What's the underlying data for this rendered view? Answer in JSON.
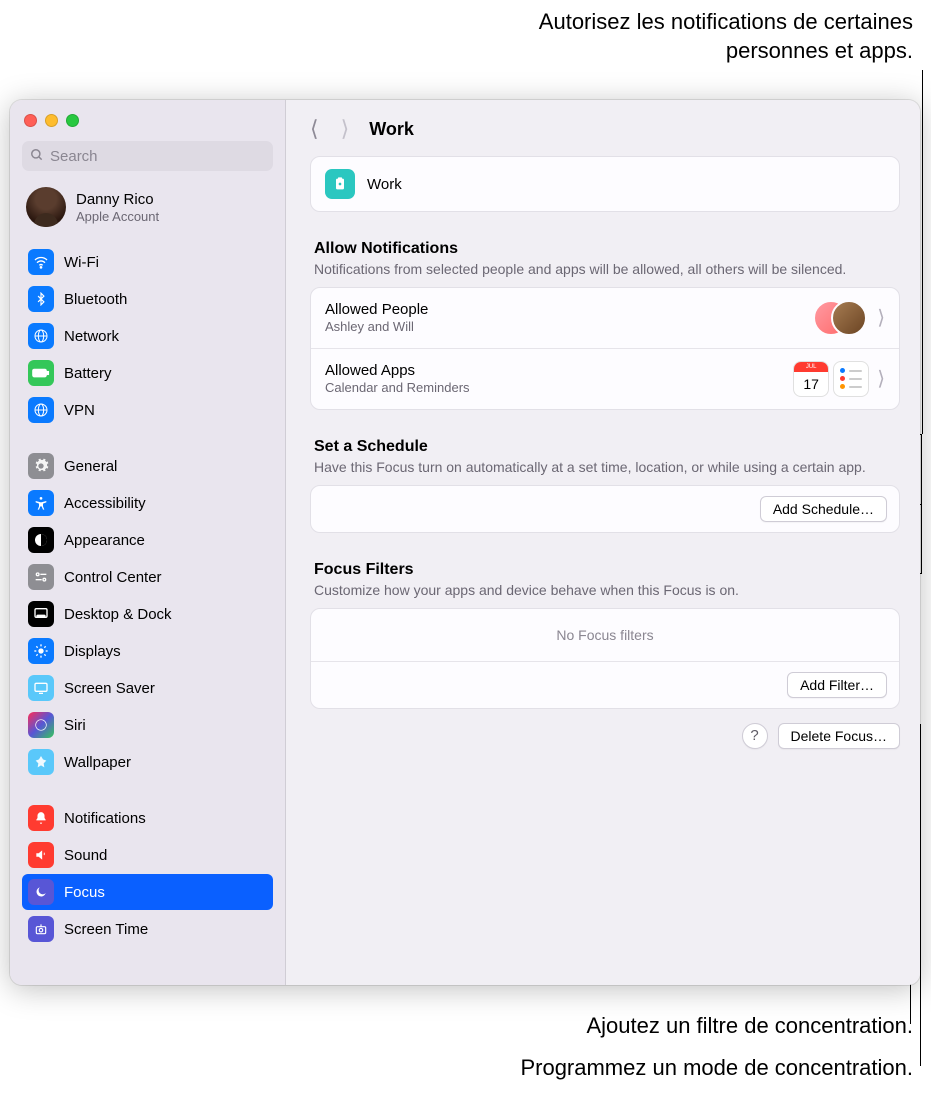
{
  "annotations": {
    "top": "Autorisez les notifications de certaines personnes et apps.",
    "filter": "Ajoutez un filtre de concentration.",
    "schedule": "Programmez un mode de concentration."
  },
  "search": {
    "placeholder": "Search"
  },
  "profile": {
    "name": "Danny Rico",
    "subtitle": "Apple Account"
  },
  "sidebar": {
    "group1": [
      {
        "label": "Wi-Fi",
        "icon": "wifi",
        "bg": "#0a7aff"
      },
      {
        "label": "Bluetooth",
        "icon": "bluetooth",
        "bg": "#0a7aff"
      },
      {
        "label": "Network",
        "icon": "network",
        "bg": "#0a7aff"
      },
      {
        "label": "Battery",
        "icon": "battery",
        "bg": "#34c759"
      },
      {
        "label": "VPN",
        "icon": "vpn",
        "bg": "#0a7aff"
      }
    ],
    "group2": [
      {
        "label": "General",
        "icon": "gear",
        "bg": "#8e8e93"
      },
      {
        "label": "Accessibility",
        "icon": "accessibility",
        "bg": "#0a7aff"
      },
      {
        "label": "Appearance",
        "icon": "appearance",
        "bg": "#000"
      },
      {
        "label": "Control Center",
        "icon": "control-center",
        "bg": "#8e8e93"
      },
      {
        "label": "Desktop & Dock",
        "icon": "dock",
        "bg": "#000"
      },
      {
        "label": "Displays",
        "icon": "displays",
        "bg": "#0a7aff"
      },
      {
        "label": "Screen Saver",
        "icon": "screensaver",
        "bg": "#5ac8fa"
      },
      {
        "label": "Siri",
        "icon": "siri",
        "bg": "#1c1c1e"
      },
      {
        "label": "Wallpaper",
        "icon": "wallpaper",
        "bg": "#5ac8fa"
      }
    ],
    "group3": [
      {
        "label": "Notifications",
        "icon": "bell",
        "bg": "#ff3b30"
      },
      {
        "label": "Sound",
        "icon": "sound",
        "bg": "#ff3b30"
      },
      {
        "label": "Focus",
        "icon": "focus",
        "bg": "#5856d6",
        "selected": true
      },
      {
        "label": "Screen Time",
        "icon": "screentime",
        "bg": "#5856d6"
      }
    ]
  },
  "header": {
    "title": "Work"
  },
  "focus": {
    "name": "Work"
  },
  "allow": {
    "title": "Allow Notifications",
    "desc": "Notifications from selected people and apps will be allowed, all others will be silenced.",
    "people": {
      "title": "Allowed People",
      "subtitle": "Ashley and Will"
    },
    "apps": {
      "title": "Allowed Apps",
      "subtitle": "Calendar and Reminders",
      "calDay": "17",
      "calMonth": "JUL"
    }
  },
  "schedule": {
    "title": "Set a Schedule",
    "desc": "Have this Focus turn on automatically at a set time, location, or while using a certain app.",
    "button": "Add Schedule…"
  },
  "filters": {
    "title": "Focus Filters",
    "desc": "Customize how your apps and device behave when this Focus is on.",
    "empty": "No Focus filters",
    "button": "Add Filter…"
  },
  "footer": {
    "help": "?",
    "delete": "Delete Focus…"
  }
}
